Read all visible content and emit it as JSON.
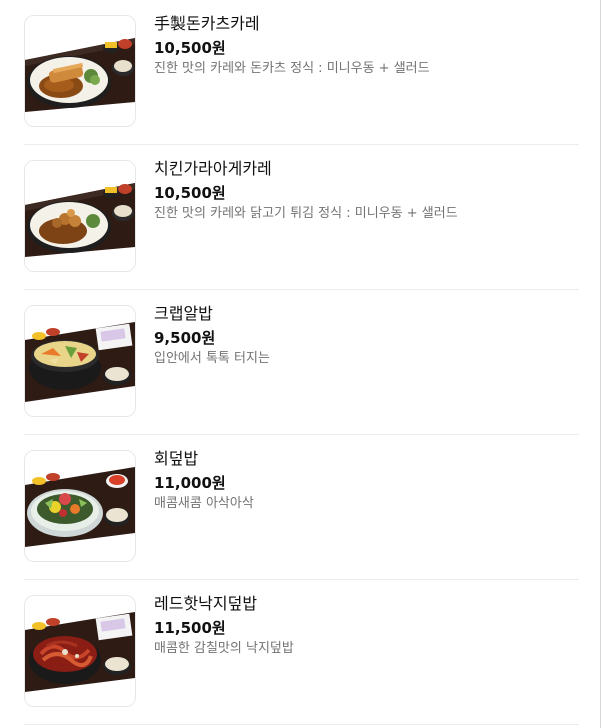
{
  "menu": {
    "items": [
      {
        "name": "手製돈카츠카레",
        "price": "10,500원",
        "description": "진한 맛의 카레와 돈카츠 정식 : 미니우동 + 샐러드",
        "image": "curry-tonkatsu-set-photo"
      },
      {
        "name": "치킨가라아게카레",
        "price": "10,500원",
        "description": "진한 맛의 카레와 닭고기 튀김 정식 : 미니우동 + 샐러드",
        "image": "curry-karaage-set-photo"
      },
      {
        "name": "크랩알밥",
        "price": "9,500원",
        "description": "입안에서 톡톡 터지는",
        "image": "crab-roe-rice-set-photo"
      },
      {
        "name": "회덮밥",
        "price": "11,000원",
        "description": "매콤새콤 아삭아삭",
        "image": "sashimi-rice-bowl-set-photo"
      },
      {
        "name": "레드핫낙지덮밥",
        "price": "11,500원",
        "description": "매콤한 감칠맛의 낙지덮밥",
        "image": "spicy-octopus-rice-set-photo"
      }
    ]
  }
}
